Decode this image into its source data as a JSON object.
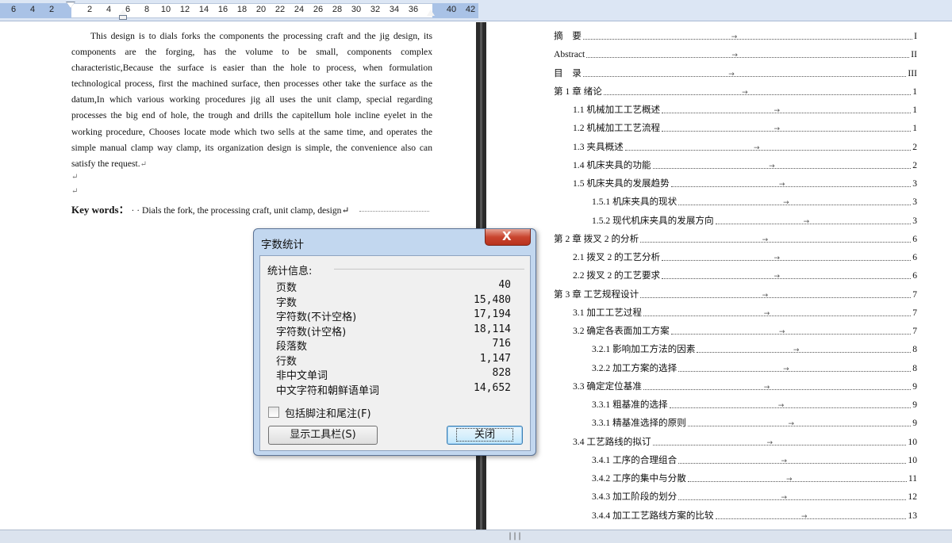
{
  "ruler": {
    "ticks": [
      "6",
      "4",
      "2",
      "2",
      "4",
      "6",
      "8",
      "10",
      "12",
      "14",
      "16",
      "18",
      "20",
      "22",
      "24",
      "26",
      "28",
      "30",
      "32",
      "34",
      "36",
      "40",
      "42"
    ]
  },
  "abstract": {
    "body": "This design is to dials forks the components the processing craft and the jig design, its components are the forging, has the volume to be small, components complex characteristic,Because the surface is easier than the hole to process, when formulation technological process, first the machined surface, then processes other take the surface as the datum,In which various working procedures jig all uses the unit clamp, special regarding processes the big end of hole, the trough and drills the capitellum hole incline eyelet in the working procedure, Chooses locate mode which two sells at the same time, and operates the simple manual clamp way clamp, its organization design is simple, the convenience also can satisfy the request.",
    "para_mark": "↵",
    "keywords_label": "Key words：",
    "keywords_text": "· · Dials the fork, the processing craft, unit clamp, design↵"
  },
  "toc": {
    "entries": [
      {
        "text": "摘　要",
        "page": "I",
        "level": 0
      },
      {
        "text": "Abstract",
        "page": "II",
        "level": 0
      },
      {
        "text": "目　录",
        "page": "III",
        "level": 0
      },
      {
        "text": "第 1 章  绪论",
        "page": "1",
        "level": 0
      },
      {
        "text": "1.1  机械加工工艺概述",
        "page": "1",
        "level": 1
      },
      {
        "text": "1.2 机械加工工艺流程",
        "page": "1",
        "level": 1
      },
      {
        "text": "1.3 夹具概述",
        "page": "2",
        "level": 1
      },
      {
        "text": "1.4 机床夹具的功能",
        "page": "2",
        "level": 1
      },
      {
        "text": "1.5 机床夹具的发展趋势",
        "page": "3",
        "level": 1
      },
      {
        "text": "1.5.1 机床夹具的现状",
        "page": "3",
        "level": 2
      },
      {
        "text": "1.5.2 现代机床夹具的发展方向",
        "page": "3",
        "level": 2
      },
      {
        "text": "第 2 章  拨叉 2 的分析",
        "page": "6",
        "level": 0
      },
      {
        "text": "2.1 拨叉 2 的工艺分析",
        "page": "6",
        "level": 1
      },
      {
        "text": "2.2 拨叉 2 的工艺要求",
        "page": "6",
        "level": 1
      },
      {
        "text": "第 3 章  工艺规程设计",
        "page": "7",
        "level": 0
      },
      {
        "text": "3.1  加工工艺过程",
        "page": "7",
        "level": 1
      },
      {
        "text": "3.2 确定各表面加工方案",
        "page": "7",
        "level": 1
      },
      {
        "text": "3.2.1 影响加工方法的因素",
        "page": "8",
        "level": 2
      },
      {
        "text": "3.2.2 加工方案的选择",
        "page": "8",
        "level": 2
      },
      {
        "text": "3.3  确定定位基准",
        "page": "9",
        "level": 1
      },
      {
        "text": "3.3.1 粗基准的选择",
        "page": "9",
        "level": 2
      },
      {
        "text": "3.3.1  精基准选择的原则",
        "page": "9",
        "level": 2
      },
      {
        "text": "3.4 工艺路线的拟订",
        "page": "10",
        "level": 1
      },
      {
        "text": "3.4.1 工序的合理组合",
        "page": "10",
        "level": 2
      },
      {
        "text": "3.4.2 工序的集中与分散",
        "page": "11",
        "level": 2
      },
      {
        "text": "3.4.3 加工阶段的划分",
        "page": "12",
        "level": 2
      },
      {
        "text": "3.4.4 加工工艺路线方案的比较",
        "page": "13",
        "level": 2
      }
    ]
  },
  "dialog": {
    "title": "字数统计",
    "close_glyph": "X",
    "group_label": "统计信息:",
    "stats": [
      {
        "label": "页数",
        "value": "40"
      },
      {
        "label": "字数",
        "value": "15,480"
      },
      {
        "label": "字符数(不计空格)",
        "value": "17,194"
      },
      {
        "label": "字符数(计空格)",
        "value": "18,114"
      },
      {
        "label": "段落数",
        "value": "716"
      },
      {
        "label": "行数",
        "value": "1,147"
      },
      {
        "label": "非中文单词",
        "value": "828"
      },
      {
        "label": "中文字符和朝鲜语单词",
        "value": "14,652"
      }
    ],
    "checkbox_label": "包括脚注和尾注(F)",
    "checkbox_checked": false,
    "show_toolbar_button": "显示工具栏(S)",
    "close_button": "关闭"
  },
  "statusbar": {
    "grip": "|||"
  }
}
